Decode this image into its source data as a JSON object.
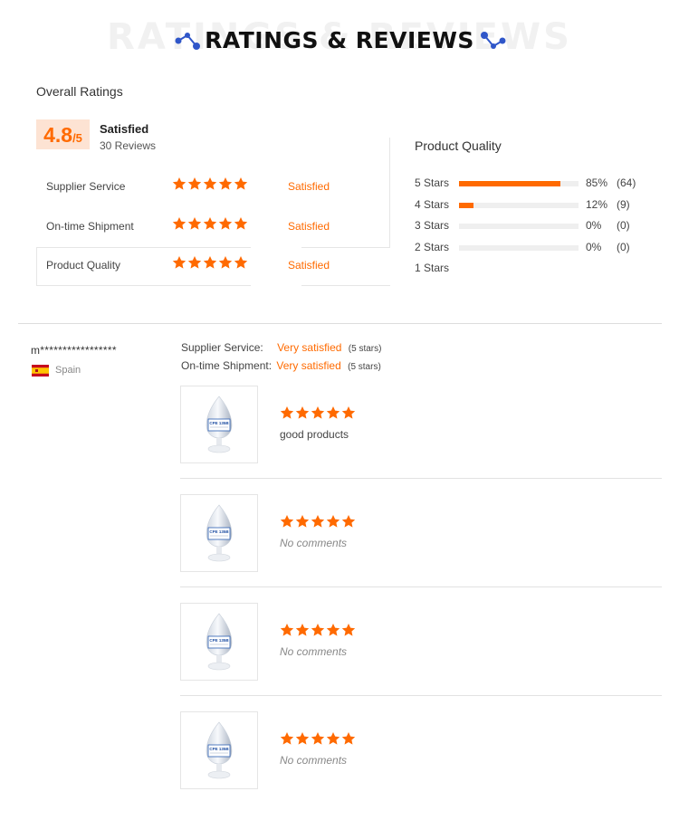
{
  "header": {
    "title": "RATINGS & REVIEWS",
    "ghost": "RATINGS & REVIEWS"
  },
  "overall": {
    "label": "Overall Ratings",
    "score": "4.8",
    "score_suffix": "/5",
    "status": "Satisfied",
    "reviews": "30 Reviews"
  },
  "ratings": [
    {
      "name": "Supplier Service",
      "stars": 5,
      "status": "Satisfied"
    },
    {
      "name": "On-time Shipment",
      "stars": 5,
      "status": "Satisfied"
    },
    {
      "name": "Product Quality",
      "stars": 5,
      "status": "Satisfied"
    }
  ],
  "product_quality": {
    "title": "Product Quality",
    "rows": [
      {
        "label": "5  Stars",
        "fill": 0.85,
        "pct": "85%",
        "count": "(64)"
      },
      {
        "label": "4  Stars",
        "fill": 0.12,
        "pct": "12%",
        "count": "(9)"
      },
      {
        "label": "3  Stars",
        "fill": 0,
        "pct": "0%",
        "count": "(0)"
      },
      {
        "label": "2  Stars",
        "fill": 0,
        "pct": "0%",
        "count": "(0)"
      },
      {
        "label": "1  Stars",
        "fill": null,
        "pct": "",
        "count": ""
      }
    ]
  },
  "review": {
    "reviewer": "m*****************",
    "country": "Spain",
    "supplier_label": "Supplier Service:",
    "supplier_value": "Very satisfied",
    "supplier_note": "(5 stars)",
    "shipment_label": "On-time Shipment:",
    "shipment_value": "Very satisfied",
    "shipment_note": "(5 stars)",
    "items": [
      {
        "stars": 5,
        "comment": "good products",
        "empty": false
      },
      {
        "stars": 5,
        "comment": "No comments",
        "empty": true
      },
      {
        "stars": 5,
        "comment": "No comments",
        "empty": true
      },
      {
        "stars": 5,
        "comment": "No comments",
        "empty": true
      }
    ],
    "product_label": "CPE 135B"
  },
  "colors": {
    "accent": "#ff6a00",
    "score_bg": "#fde3d3",
    "icon_blue": "#2f56c9"
  },
  "icons": [
    "molecule-icon",
    "star-icon",
    "spain-flag-icon"
  ]
}
